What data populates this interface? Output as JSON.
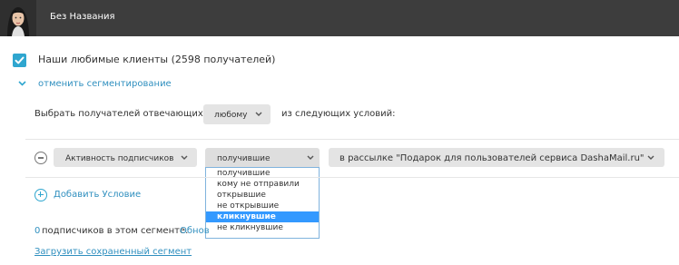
{
  "header": {
    "app_title": "Без Названия",
    "avatar_icon": "woman-portrait-avatar"
  },
  "list": {
    "checked": true,
    "title": "Наши любимые клиенты (2598 получателей)",
    "cancel_segmentation": "отменить сегментирование"
  },
  "filter": {
    "select_label": "Выбрать получателей отвечающих",
    "match_mode": "любому",
    "conditions_label": "из следующих условий:"
  },
  "condition": {
    "field": "Активность подписчиков",
    "operator": "получившие",
    "target": "в рассылке \"Подарок для пользователей сервиса DashaMail.ru\""
  },
  "operator_options": [
    {
      "label": "получившие",
      "selected": false
    },
    {
      "label": "кому не отправили",
      "selected": false
    },
    {
      "label": "открывшие",
      "selected": false
    },
    {
      "label": "не открывшие",
      "selected": false
    },
    {
      "label": "кликнувшие",
      "selected": true
    },
    {
      "label": "не кликнувшие",
      "selected": false
    }
  ],
  "actions": {
    "add_condition": "Добавить Условие"
  },
  "summary": {
    "count": "0",
    "text": "подписчиков в этом сегменте.",
    "refresh": "Обнов"
  },
  "load_segment": "Загрузить сохраненный сегмент",
  "colors": {
    "accent": "#2fa6cf",
    "link": "#2f8fbf",
    "topbar": "#3d3d3d",
    "selected_option": "#3399ff"
  }
}
